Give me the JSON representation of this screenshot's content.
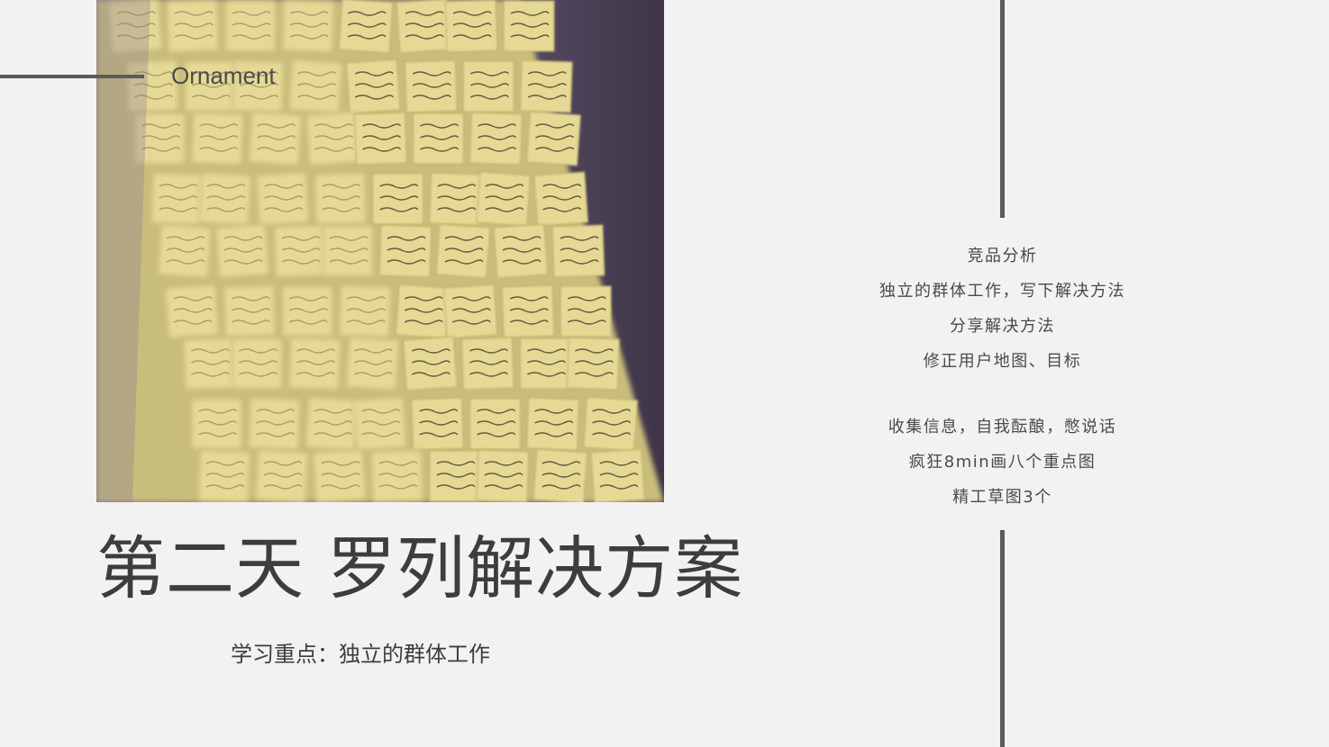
{
  "ornament": {
    "label": "Ornament"
  },
  "title": "第二天 罗列解决方案",
  "subtitle": "学习重点：独立的群体工作",
  "notes": {
    "group1": [
      "竞品分析",
      "独立的群体工作，写下解决方法",
      "分享解决方法",
      "修正用户地图、目标"
    ],
    "group2": [
      "收集信息，自我酝酿，憋说话",
      "疯狂8min画八个重点图",
      "精工草图3个"
    ]
  },
  "colors": {
    "background": "#f2f2f2",
    "text": "#3d3d3d",
    "rule": "#5b5b5b",
    "note_paper": "#e8dc9a"
  }
}
